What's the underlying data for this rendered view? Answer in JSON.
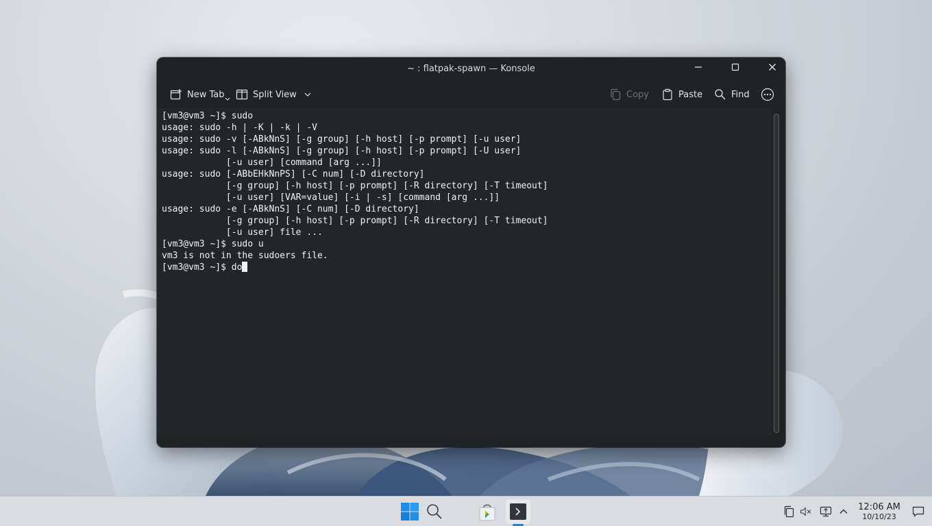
{
  "window": {
    "title": "~ : flatpak-spawn — Konsole"
  },
  "toolbar": {
    "new_tab": "New Tab",
    "split_view": "Split View",
    "copy": "Copy",
    "paste": "Paste",
    "find": "Find"
  },
  "terminal": {
    "lines": [
      "[vm3@vm3 ~]$ sudo",
      "usage: sudo -h | -K | -k | -V",
      "usage: sudo -v [-ABkNnS] [-g group] [-h host] [-p prompt] [-u user]",
      "usage: sudo -l [-ABkNnS] [-g group] [-h host] [-p prompt] [-U user]",
      "            [-u user] [command [arg ...]]",
      "usage: sudo [-ABbEHkNnPS] [-C num] [-D directory]",
      "            [-g group] [-h host] [-p prompt] [-R directory] [-T timeout]",
      "            [-u user] [VAR=value] [-i | -s] [command [arg ...]]",
      "usage: sudo -e [-ABkNnS] [-C num] [-D directory]",
      "            [-g group] [-h host] [-p prompt] [-R directory] [-T timeout]",
      "            [-u user] file ...",
      "[vm3@vm3 ~]$ sudo u",
      "vm3 is not in the sudoers file.",
      "[vm3@vm3 ~]$ do"
    ]
  },
  "taskbar": {
    "time": "12:06 AM",
    "date": "10/10/23",
    "indicator_color": "#2a7fd6"
  },
  "colors": {
    "terminal_bg": "#232629",
    "window_bg": "#202326",
    "terminal_fg": "#f2f2f2"
  }
}
